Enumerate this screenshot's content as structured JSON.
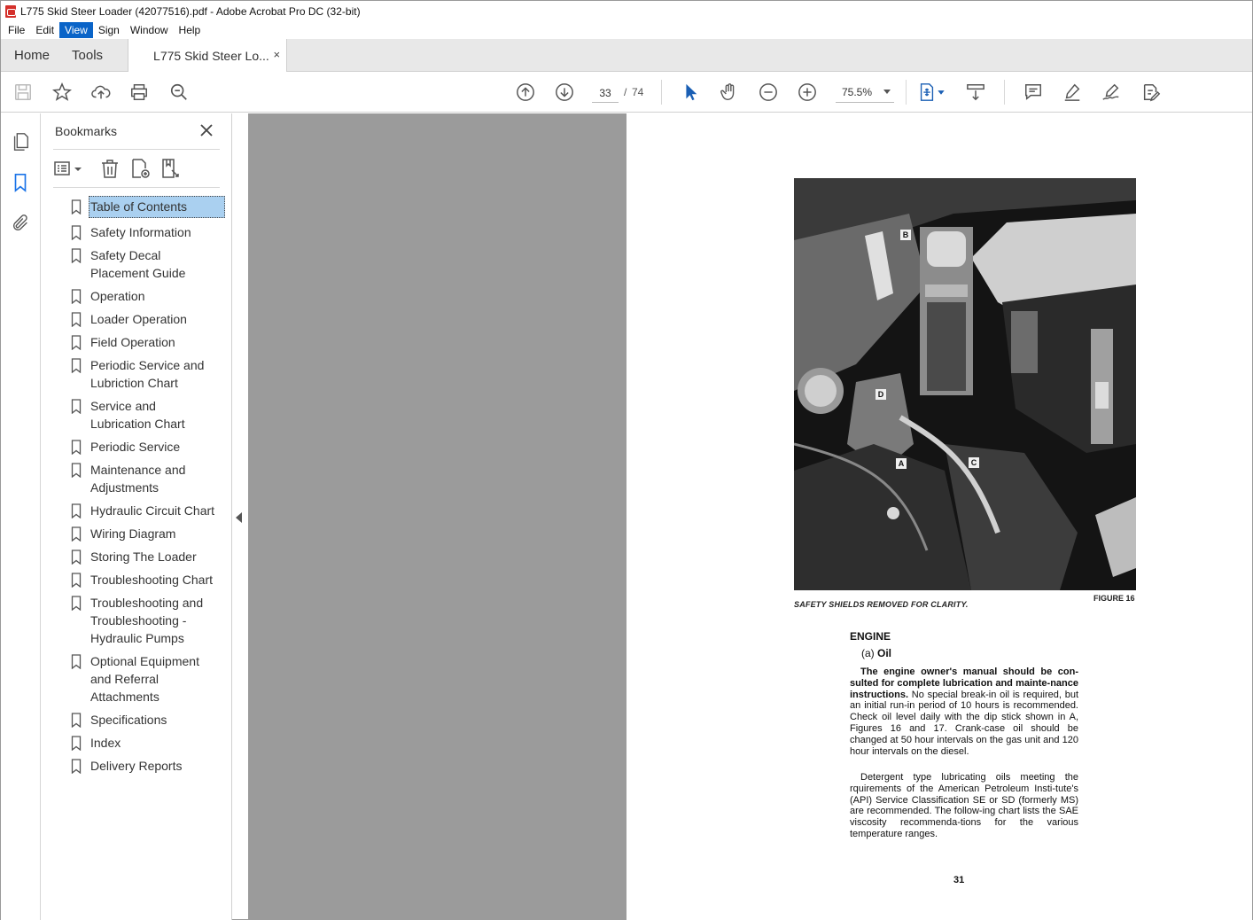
{
  "window": {
    "title": "L775 Skid Steer Loader (42077516).pdf - Adobe Acrobat Pro DC (32-bit)"
  },
  "menubar": {
    "items": [
      "File",
      "Edit",
      "View",
      "Sign",
      "Window",
      "Help"
    ],
    "active": "View"
  },
  "tabs": {
    "home": "Home",
    "tools": "Tools",
    "document": "L775 Skid Steer Lo...",
    "close_glyph": "×"
  },
  "toolbar": {
    "current_page": "33",
    "separator": "/",
    "total_pages": "74",
    "zoom": "75.5%",
    "icons": [
      "save-icon",
      "star-icon",
      "upload-icon",
      "print-icon",
      "zoom-search-icon",
      "page-up-icon",
      "page-down-icon",
      "select-arrow-icon",
      "hand-icon",
      "zoom-out-icon",
      "zoom-in-icon",
      "fit-page-icon",
      "scroll-mode-icon",
      "comment-icon",
      "highlight-icon",
      "sign-icon",
      "edit-pdf-icon"
    ]
  },
  "bookmarks_panel": {
    "title": "Bookmarks",
    "items": [
      {
        "label": "Table of Contents",
        "selected": true
      },
      {
        "label": "Safety Information"
      },
      {
        "label": "Safety Decal Placement Guide"
      },
      {
        "label": "Operation"
      },
      {
        "label": "Loader Operation"
      },
      {
        "label": "Field Operation"
      },
      {
        "label": "Periodic Service and Lubriction Chart"
      },
      {
        "label": "Service and Lubrication Chart"
      },
      {
        "label": "Periodic Service"
      },
      {
        "label": "Maintenance and Adjustments"
      },
      {
        "label": "Hydraulic Circuit Chart"
      },
      {
        "label": "Wiring Diagram"
      },
      {
        "label": "Storing The Loader"
      },
      {
        "label": "Troubleshooting Chart"
      },
      {
        "label": "Troubleshooting and Troubleshooting - Hydraulic Pumps"
      },
      {
        "label": "Optional Equipment and Referral Attachments"
      },
      {
        "label": "Specifications"
      },
      {
        "label": "Index"
      },
      {
        "label": "Delivery Reports"
      }
    ]
  },
  "document_page": {
    "figure_callouts": [
      "B",
      "D",
      "A",
      "C"
    ],
    "caption_left": "SAFETY SHIELDS REMOVED FOR CLARITY.",
    "caption_right": "FIGURE 16",
    "section_heading": "ENGINE",
    "subheading_prefix": "(a)",
    "subheading": "Oil",
    "para1_bold": "The engine owner's manual should be con-sulted for complete lubrication and mainte-nance instructions.",
    "para1_rest": " No special break-in oil is required, but an initial run-in period of 10 hours is recommended. Check oil level daily with the dip stick shown in A, Figures 16 and 17. Crank-case oil should be changed at 50 hour intervals on the gas unit and 120 hour intervals on the diesel.",
    "para2": "Detergent type lubricating oils meeting the rquirements of the American Petroleum Insti-tute's (API) Service Classification SE or SD (formerly MS) are recommended. The follow-ing chart lists the SAE viscosity recommenda-tions for the various temperature ranges.",
    "page_number": "31"
  }
}
